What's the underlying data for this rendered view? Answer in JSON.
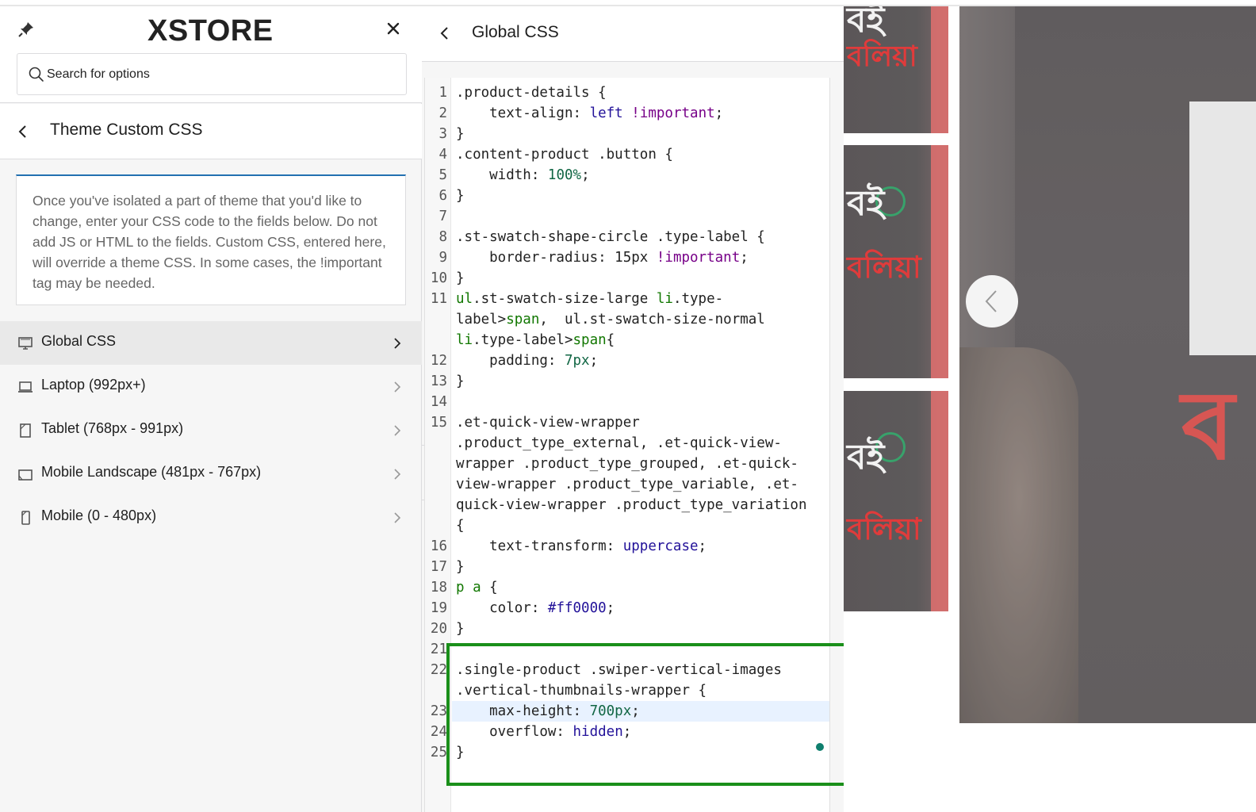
{
  "app": {
    "logo_text": "XSTORE"
  },
  "search": {
    "placeholder": "Search for options"
  },
  "section": {
    "title": "Theme Custom CSS",
    "description": "Once you've isolated a part of theme that you'd like to change, enter your CSS code to the fields below. Do not add JS or HTML to the fields. Custom CSS, entered here, will override a theme CSS. In some cases, the !important tag may be needed."
  },
  "menu": {
    "items": [
      {
        "label": "Global CSS",
        "icon": "desktop-icon",
        "active": true
      },
      {
        "label": "Laptop (992px+)",
        "icon": "laptop-icon",
        "active": false
      },
      {
        "label": "Tablet (768px - 991px)",
        "icon": "tablet-icon",
        "active": false
      },
      {
        "label": "Mobile Landscape (481px - 767px)",
        "icon": "tablet-landscape-icon",
        "active": false
      },
      {
        "label": "Mobile (0 - 480px)",
        "icon": "mobile-icon",
        "active": false
      }
    ]
  },
  "editor": {
    "title": "Global CSS",
    "lines": [
      {
        "n": "1",
        "text": ".product-details {"
      },
      {
        "n": "2",
        "text": "    text-align: left !important;"
      },
      {
        "n": "3",
        "text": "}"
      },
      {
        "n": "4",
        "text": ".content-product .button {"
      },
      {
        "n": "5",
        "text": "    width: 100%;"
      },
      {
        "n": "6",
        "text": "}"
      },
      {
        "n": "7",
        "text": ""
      },
      {
        "n": "8",
        "text": ".st-swatch-shape-circle .type-label {"
      },
      {
        "n": "9",
        "text": "    border-radius: 15px !important;"
      },
      {
        "n": "10",
        "text": "}"
      },
      {
        "n": "11",
        "text": "ul.st-swatch-size-large li.type-"
      },
      {
        "n": "",
        "text": "label>span,  ul.st-swatch-size-normal"
      },
      {
        "n": "",
        "text": "li.type-label>span{"
      },
      {
        "n": "12",
        "text": "    padding: 7px;"
      },
      {
        "n": "13",
        "text": "}"
      },
      {
        "n": "14",
        "text": ""
      },
      {
        "n": "15",
        "text": ".et-quick-view-wrapper"
      },
      {
        "n": "",
        "text": ".product_type_external, .et-quick-view-"
      },
      {
        "n": "",
        "text": "wrapper .product_type_grouped, .et-quick-"
      },
      {
        "n": "",
        "text": "view-wrapper .product_type_variable, .et-"
      },
      {
        "n": "",
        "text": "quick-view-wrapper .product_type_variation"
      },
      {
        "n": "",
        "text": "{"
      },
      {
        "n": "16",
        "text": "    text-transform: uppercase;"
      },
      {
        "n": "17",
        "text": "}"
      },
      {
        "n": "18",
        "text": "p a {"
      },
      {
        "n": "19",
        "text": "    color: #ff0000;"
      },
      {
        "n": "20",
        "text": "}"
      },
      {
        "n": "21",
        "text": ""
      },
      {
        "n": "22",
        "text": ".single-product .swiper-vertical-images"
      },
      {
        "n": "",
        "text": ".vertical-thumbnails-wrapper {"
      },
      {
        "n": "23",
        "text": "    max-height: 700px;"
      },
      {
        "n": "24",
        "text": "    overflow: hidden;"
      },
      {
        "n": "25",
        "text": "}"
      }
    ],
    "active_line": "23"
  },
  "colors": {
    "accent": "#2271b1",
    "highlight_box": "#1a8f1a",
    "active_line_bg": "#e8f2ff",
    "status_dot": "#0f7f6e"
  },
  "preview": {
    "thumb_text_1": "বই",
    "thumb_text_2": "বলিয়া"
  }
}
